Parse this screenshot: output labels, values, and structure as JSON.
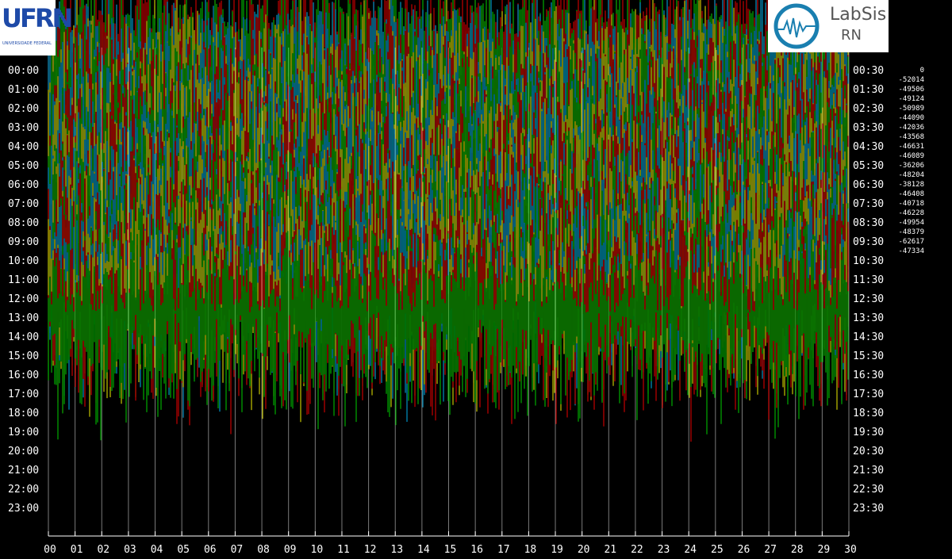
{
  "chart_data": {
    "type": "line",
    "title": "",
    "xlabel": "",
    "ylabel": "",
    "x_ticks": [
      "00",
      "01",
      "02",
      "03",
      "04",
      "05",
      "06",
      "07",
      "08",
      "09",
      "10",
      "11",
      "12",
      "13",
      "14",
      "15",
      "16",
      "17",
      "18",
      "19",
      "20",
      "21",
      "22",
      "23",
      "24",
      "25",
      "26",
      "27",
      "28",
      "29",
      "30"
    ],
    "left_hour_labels": [
      "00:00",
      "01:00",
      "02:00",
      "03:00",
      "04:00",
      "05:00",
      "06:00",
      "07:00",
      "08:00",
      "09:00",
      "10:00",
      "11:00",
      "12:00",
      "13:00",
      "14:00",
      "15:00",
      "16:00",
      "17:00",
      "18:00",
      "19:00",
      "20:00",
      "21:00",
      "22:00",
      "23:00"
    ],
    "right_hour_labels": [
      "00:30",
      "01:30",
      "02:30",
      "03:30",
      "04:30",
      "05:30",
      "06:30",
      "07:30",
      "08:30",
      "09:30",
      "10:30",
      "11:30",
      "12:30",
      "13:30",
      "14:30",
      "15:30",
      "16:30",
      "17:30",
      "18:30",
      "19:30",
      "20:30",
      "21:30",
      "22:30",
      "23:30"
    ],
    "trace_offsets": [
      "0",
      "-52014",
      "-49506",
      "-49124",
      "-50989",
      "-44090",
      "-42036",
      "-43568",
      "-46631",
      "-46089",
      "-36206",
      "-48204",
      "-38128",
      "-46408",
      "-40718",
      "-46228",
      "-49954",
      "-48379",
      "-62617",
      "-47334"
    ],
    "trace_colors": [
      "#ff0000",
      "#00e000",
      "#00c0ff",
      "#ffff00"
    ],
    "recorded_rows": 26,
    "grid": true,
    "legend": "none"
  },
  "logos": {
    "left": {
      "text": "UFRN",
      "subtitle": "UNIVERSIDADE FEDERAL DO RIO GRANDE DO NORTE"
    },
    "right": {
      "line1": "LabSis",
      "line2": "RN"
    }
  },
  "colors": {
    "background": "#000000",
    "text": "#ffffff",
    "grid": "#7a7a7a"
  }
}
